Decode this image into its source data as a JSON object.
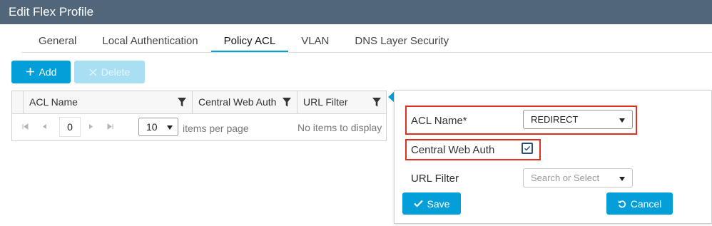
{
  "window": {
    "title": "Edit Flex Profile"
  },
  "tabs": [
    {
      "label": "General",
      "active": false
    },
    {
      "label": "Local Authentication",
      "active": false
    },
    {
      "label": "Policy ACL",
      "active": true
    },
    {
      "label": "VLAN",
      "active": false
    },
    {
      "label": "DNS Layer Security",
      "active": false
    }
  ],
  "toolbar": {
    "add_icon": "plus-icon",
    "add_label": "Add",
    "delete_icon": "close-icon",
    "delete_label": "Delete",
    "delete_enabled": false
  },
  "table": {
    "columns": [
      "ACL Name",
      "Central Web Auth",
      "URL Filter"
    ],
    "rows": [],
    "pager": {
      "current_page": "0",
      "page_size": "10",
      "items_per_page_label": "items per page",
      "empty_message": "No items to display"
    }
  },
  "form": {
    "acl_name": {
      "label": "ACL Name*",
      "value": "REDIRECT"
    },
    "central_web_auth": {
      "label": "Central Web Auth",
      "checked": true
    },
    "url_filter": {
      "label": "URL Filter",
      "placeholder": "Search or Select",
      "value": ""
    },
    "save_label": "Save",
    "save_icon": "checkmark-icon",
    "cancel_label": "Cancel",
    "cancel_icon": "undo-icon"
  },
  "colors": {
    "title_bar": "#52667a",
    "accent": "#049fd9",
    "highlight_box": "#e0301e"
  }
}
